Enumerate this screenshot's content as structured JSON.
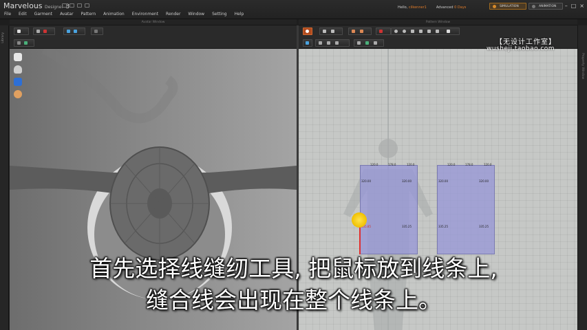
{
  "app": {
    "logo_main": "Marvelous",
    "logo_sub": "Designer",
    "logo_ver": "3"
  },
  "menu": [
    "File",
    "Edit",
    "Garment",
    "Avatar",
    "Pattern",
    "Animation",
    "Environment",
    "Render",
    "Window",
    "Setting",
    "Help"
  ],
  "user": {
    "hello": "Hello,",
    "name": "cilkenner1",
    "plan": "Advanced",
    "days": "0 Days"
  },
  "modes": {
    "simulation": "SIMULATION",
    "animation": "ANIMATION"
  },
  "windows": {
    "avatar": "Avatar Window",
    "pattern": "Pattern Window"
  },
  "docks": {
    "left": "Library",
    "right": "Property Window"
  },
  "patterns": {
    "left": {
      "top_a": "120.0",
      "top_b": "178.0",
      "top_c": "120.0",
      "side_l": "320.00",
      "side_r": "320.00",
      "lower_l": "335.25",
      "lower_l2": "335.85",
      "lower_r": "335.25"
    },
    "right": {
      "top_a": "120.0",
      "top_b": "178.0",
      "top_c": "120.0",
      "side_l": "320.00",
      "side_r": "320.00",
      "lower_l": "335.25",
      "lower_r": "335.25"
    }
  },
  "watermark": {
    "line1": "【无设计工作室】",
    "line2": "wusheji.taobao.com"
  },
  "subtitles": {
    "line1": "首先选择线缝纫工具, 把鼠标放到线条上,",
    "line2": "缝合线会出现在整个线条上。"
  },
  "colors": {
    "accent": "#e07b2a",
    "pattern_fill": "#9696d7",
    "seam": "#e03030",
    "cursor": "#f0c000"
  }
}
